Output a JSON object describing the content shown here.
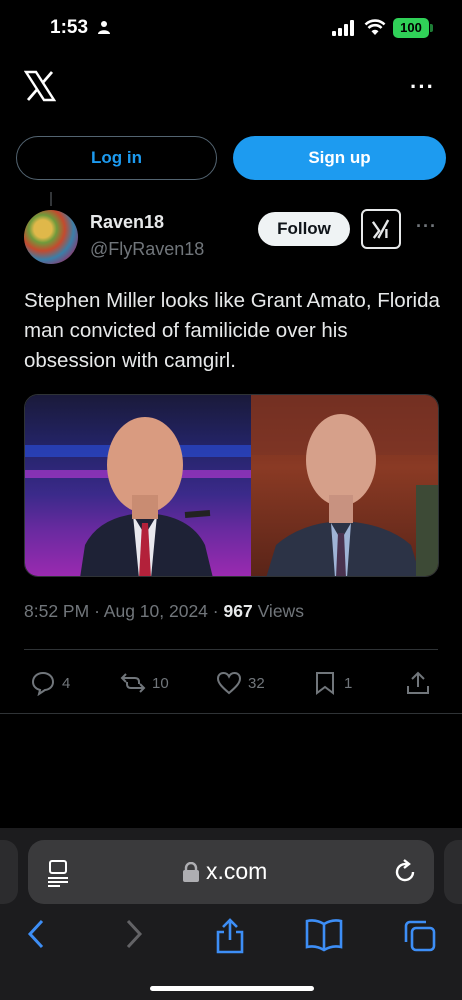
{
  "status_bar": {
    "time": "1:53",
    "battery": "100"
  },
  "header": {
    "more_label": "···"
  },
  "auth": {
    "login_label": "Log in",
    "signup_label": "Sign up"
  },
  "author": {
    "name": "Raven18",
    "handle": "@FlyRaven18",
    "follow_label": "Follow",
    "more_label": "···"
  },
  "tweet": {
    "text": "Stephen Miller looks like Grant Amato, Florida man convicted of familicide over his obsession with camgirl.",
    "time": "8:52 PM",
    "date": "Aug 10, 2024",
    "views_count": "967",
    "views_label": "Views"
  },
  "actions": {
    "replies": "4",
    "reposts": "10",
    "likes": "32",
    "bookmarks": "1"
  },
  "browser": {
    "url": "x.com"
  },
  "colors": {
    "accent": "#1d9bf0",
    "background": "#000000",
    "secondary_text": "#71767b"
  },
  "icons": [
    "x-logo-icon",
    "person-icon",
    "signal-icon",
    "wifi-icon",
    "battery-icon",
    "grok-icon",
    "reply-icon",
    "repost-icon",
    "like-icon",
    "bookmark-icon",
    "share-icon",
    "reader-icon",
    "lock-icon",
    "reload-icon",
    "back-icon",
    "forward-icon",
    "browser-share-icon",
    "bookmarks-book-icon",
    "tabs-icon"
  ]
}
